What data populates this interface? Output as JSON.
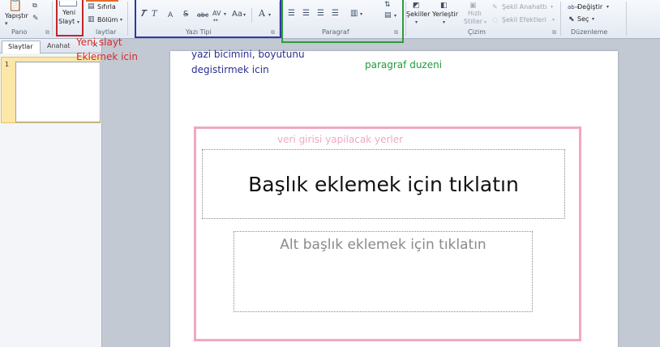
{
  "ribbon": {
    "pano": {
      "paste_label": "Yapıştır",
      "group_label": "Pano"
    },
    "slaytlar": {
      "new_slide_line1": "Yeni",
      "new_slide_line2": "Slayt",
      "reset_label": "Sıfırla",
      "section_label": "Bölüm",
      "group_label": "laytlar"
    },
    "font": {
      "italic": "T",
      "strike_s": "S",
      "abc": "abc",
      "spacing": "AV",
      "case": "Aa",
      "color_a": "A",
      "group_label": "Yazı Tipi"
    },
    "paragraph": {
      "group_label": "Paragraf"
    },
    "drawing": {
      "shapes_label": "Şekiller",
      "arrange_label": "Yerleştir",
      "quick_styles_line1": "Hızlı",
      "quick_styles_line2": "Stiller",
      "shape_outline": "Şekil Anahattı",
      "shape_effects": "Şekil Efektleri",
      "group_label": "Çizim"
    },
    "editing": {
      "replace_label": "Değiştir",
      "select_label": "Seç",
      "group_label": "Düzenleme"
    }
  },
  "left_pane": {
    "tab_slides": "Slaytlar",
    "tab_outline": "Anahat",
    "close": "×",
    "slide_number": "1"
  },
  "slide": {
    "title_placeholder": "Başlık eklemek için tıklatın",
    "subtitle_placeholder": "Alt başlık eklemek için tıklatın"
  },
  "annotations": {
    "new_slide_line1": "Yeni slayt",
    "new_slide_line2": "Eklemek icin",
    "font_line1": "yazi bicimini, boyutunu",
    "font_line2": "degistirmek icin",
    "paragraph": "paragraf duzeni",
    "input_areas": "veri girisi yapilacak yerler"
  },
  "colors": {
    "annot_red": "#d42a2a",
    "annot_blue": "#2b2f8f",
    "annot_green": "#1f9a3a",
    "annot_pink": "#f0a8c4",
    "box_red": "#c0262c",
    "box_blue": "#2e3aa0",
    "box_green": "#2f9b3d"
  }
}
